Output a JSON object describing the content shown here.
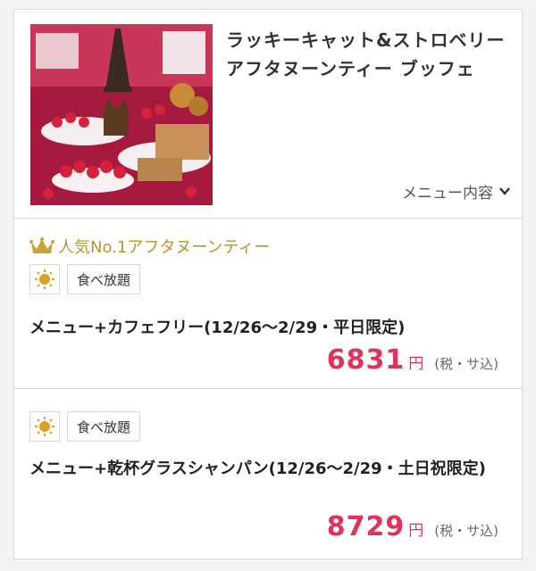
{
  "plan_header": {
    "title": "ラッキーキャット&ストロベリー アフタヌーンティー ブッフェ",
    "image_icon": "dessert-buffet-photo",
    "menu_toggle_label": "メニュー内容"
  },
  "offers": [
    {
      "badge": "人気No.1アフタヌーンティー",
      "tag_icon": "sun-icon",
      "tag_label": "食べ放題",
      "name": "メニュー+カフェフリー(12/26〜2/29・平日限定)",
      "price": "6831",
      "currency": "円",
      "tax_note": "(税・サ込)"
    },
    {
      "tag_icon": "sun-icon",
      "tag_label": "食べ放題",
      "name": "メニュー+乾杯グラスシャンパン(12/26〜2/29・土日祝限定)",
      "price": "8729",
      "currency": "円",
      "tax_note": "(税・サ込)"
    }
  ],
  "colors": {
    "price": "#e0325a",
    "badge_gold": "#b8962e",
    "border": "#dcdcdc"
  }
}
